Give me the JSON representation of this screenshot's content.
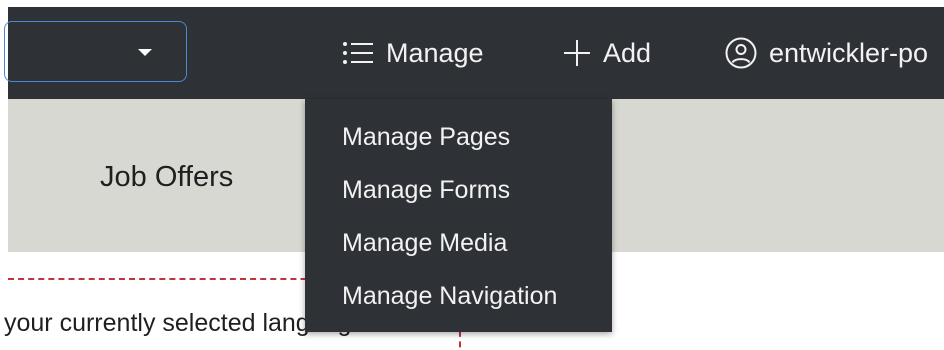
{
  "topbar": {
    "language_select": {
      "value": ""
    },
    "manage": {
      "label": "Manage",
      "icon": "list-icon"
    },
    "add": {
      "label": "Add",
      "icon": "plus-icon"
    },
    "user": {
      "label": "entwickler-po",
      "icon": "account-circle-icon"
    }
  },
  "subbar": {
    "tab_job_offers": "Job Offers"
  },
  "dropdown": {
    "items": [
      {
        "label": "Manage Pages"
      },
      {
        "label": "Manage Forms"
      },
      {
        "label": "Manage Media"
      },
      {
        "label": "Manage Navigation"
      }
    ]
  },
  "content": {
    "info_text": "your currently selected language en."
  },
  "colors": {
    "topbar_bg": "#2e3135",
    "subbar_bg": "#d8d8d3",
    "select_border": "#4a89d6",
    "dashed_outline": "#c3343a"
  }
}
